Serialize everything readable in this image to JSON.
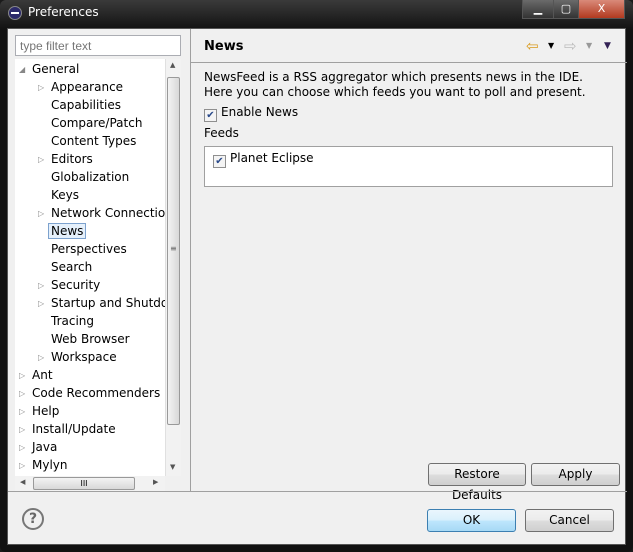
{
  "window": {
    "title": "Preferences",
    "minimize": "▁",
    "maximize": "▢",
    "close": "X"
  },
  "filter": {
    "placeholder": "type filter text"
  },
  "tree": [
    {
      "label": "General",
      "level": 0,
      "twisty": "expanded"
    },
    {
      "label": "Appearance",
      "level": 1,
      "twisty": "collapsed"
    },
    {
      "label": "Capabilities",
      "level": 1,
      "twisty": ""
    },
    {
      "label": "Compare/Patch",
      "level": 1,
      "twisty": ""
    },
    {
      "label": "Content Types",
      "level": 1,
      "twisty": ""
    },
    {
      "label": "Editors",
      "level": 1,
      "twisty": "collapsed"
    },
    {
      "label": "Globalization",
      "level": 1,
      "twisty": ""
    },
    {
      "label": "Keys",
      "level": 1,
      "twisty": ""
    },
    {
      "label": "Network Connections",
      "level": 1,
      "twisty": "collapsed"
    },
    {
      "label": "News",
      "level": 1,
      "twisty": "",
      "selected": true
    },
    {
      "label": "Perspectives",
      "level": 1,
      "twisty": ""
    },
    {
      "label": "Search",
      "level": 1,
      "twisty": ""
    },
    {
      "label": "Security",
      "level": 1,
      "twisty": "collapsed"
    },
    {
      "label": "Startup and Shutdown",
      "level": 1,
      "twisty": "collapsed"
    },
    {
      "label": "Tracing",
      "level": 1,
      "twisty": ""
    },
    {
      "label": "Web Browser",
      "level": 1,
      "twisty": ""
    },
    {
      "label": "Workspace",
      "level": 1,
      "twisty": "collapsed"
    },
    {
      "label": "Ant",
      "level": 0,
      "twisty": "collapsed"
    },
    {
      "label": "Code Recommenders",
      "level": 0,
      "twisty": "collapsed"
    },
    {
      "label": "Help",
      "level": 0,
      "twisty": "collapsed"
    },
    {
      "label": "Install/Update",
      "level": 0,
      "twisty": "collapsed"
    },
    {
      "label": "Java",
      "level": 0,
      "twisty": "collapsed"
    },
    {
      "label": "Mylyn",
      "level": 0,
      "twisty": "collapsed"
    }
  ],
  "page": {
    "title": "News",
    "description": "NewsFeed is a RSS aggregator which presents news in the IDE. Here you can choose which feeds you want to poll and present.",
    "enable_label": "Enable News",
    "enable_checked": true,
    "feeds_label": "Feeds",
    "feeds": [
      {
        "label": "Planet Eclipse",
        "checked": true
      }
    ],
    "restore_label": "Restore Defaults",
    "apply_label": "Apply"
  },
  "footer": {
    "ok_label": "OK",
    "cancel_label": "Cancel",
    "help": "?"
  }
}
